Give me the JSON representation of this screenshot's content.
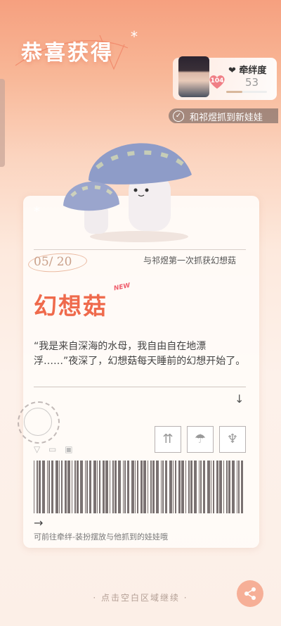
{
  "header": {
    "title": "恭喜获得",
    "sparkle_glyph": "*"
  },
  "companion": {
    "bond_label": "牵绊度",
    "bond_value": "53",
    "heart_level": "104",
    "bond_progress": 0.4,
    "caught_message": "和祁煜抓到新娃娃",
    "check_glyph": "✓"
  },
  "card": {
    "count": "05/ 20",
    "first_caught": "与祁煜第一次抓获幻想菇",
    "item_name": "幻想菇",
    "new_tag": "NEW",
    "description": "“我是来自深海的水母，我自由自在地漂浮……”夜深了，幻想菇每天睡前的幻想开始了。",
    "down_arrow": "↓",
    "right_arrow": "→",
    "footer_hint": "可前往牵绊-装扮摆放与他抓到的娃娃哦",
    "package_icons": [
      "this-way-up-icon",
      "keep-dry-icon",
      "fragile-icon"
    ]
  },
  "footer": {
    "continue_hint": "· 点击空白区域继续 ·"
  },
  "colors": {
    "accent": "#ef6a4c",
    "background_top": "#f6a07f",
    "background_bottom": "#fcefe7"
  }
}
